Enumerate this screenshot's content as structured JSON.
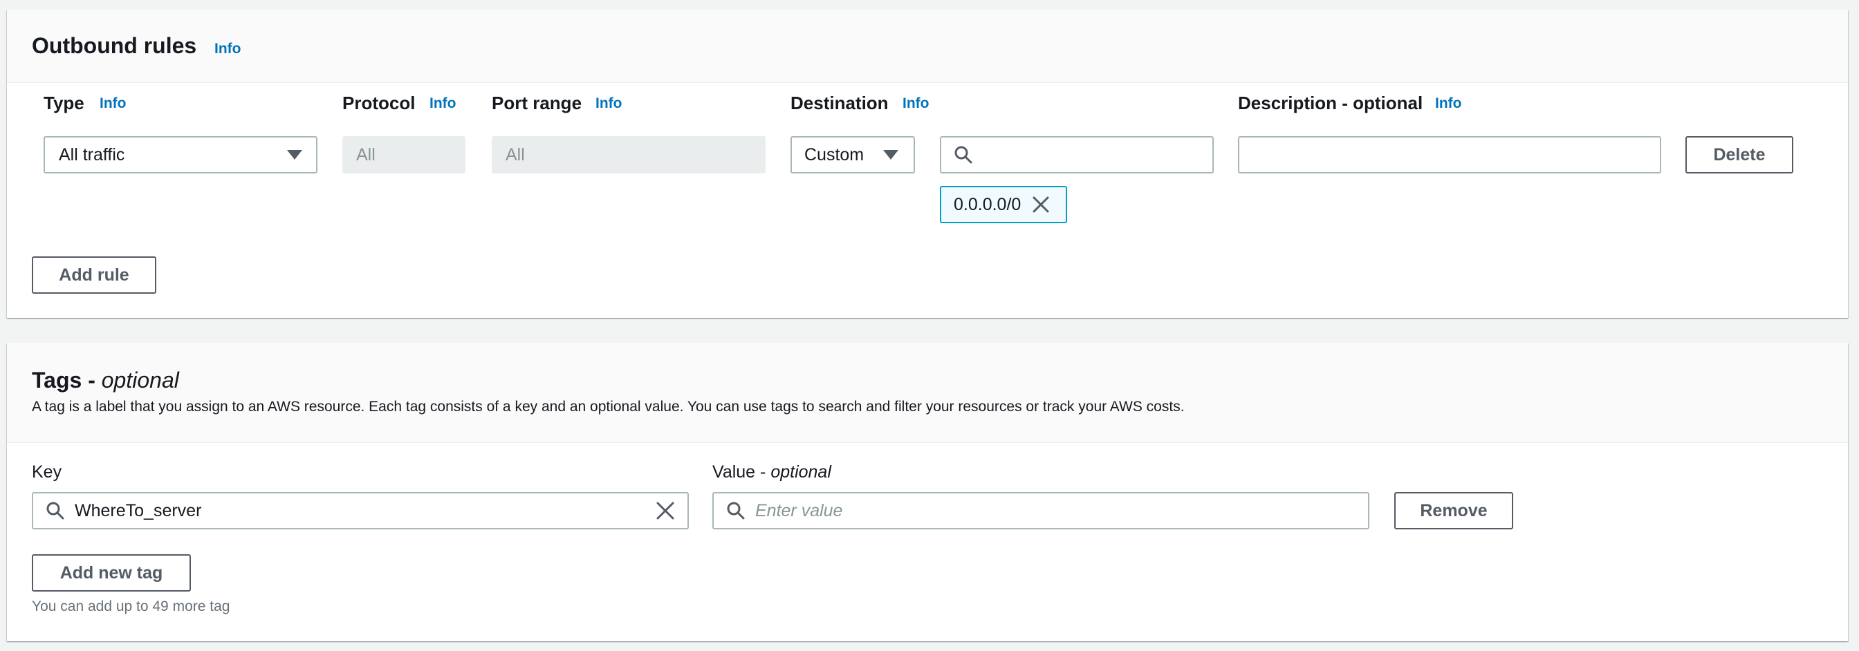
{
  "outbound": {
    "title": "Outbound rules",
    "info": "Info",
    "columns": {
      "type": "Type",
      "protocol": "Protocol",
      "port_range": "Port range",
      "destination": "Destination",
      "description": "Description - optional"
    },
    "rule": {
      "type_value": "All traffic",
      "protocol_value": "All",
      "port_range_value": "All",
      "destination_value": "Custom",
      "search_value": "",
      "token": "0.0.0.0/0",
      "description_value": ""
    },
    "delete_label": "Delete",
    "add_rule_label": "Add rule"
  },
  "tags": {
    "title_main": "Tags - ",
    "title_optional": "optional",
    "description": "A tag is a label that you assign to an AWS resource. Each tag consists of a key and an optional value. You can use tags to search and filter your resources or track your AWS costs.",
    "key_label": "Key",
    "key_value": "WhereTo_server",
    "value_label_main": "Value - ",
    "value_label_optional": "optional",
    "value_placeholder": "Enter value",
    "remove_label": "Remove",
    "add_tag_label": "Add new tag",
    "hint": "You can add up to 49 more tag"
  },
  "colors": {
    "link": "#0073bb",
    "token_border": "#00a1c9",
    "token_bg": "#f1faff"
  }
}
